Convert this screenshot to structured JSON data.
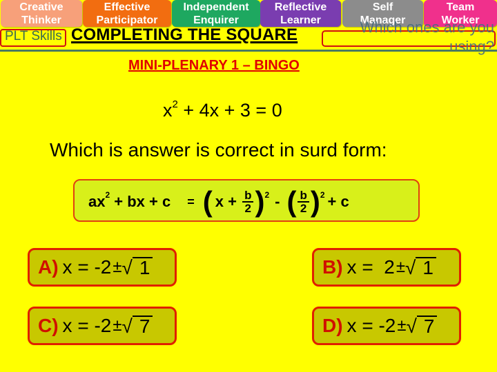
{
  "plt_skills": [
    {
      "line1": "Creative",
      "line2": "Thinker",
      "color": "#f7a07a"
    },
    {
      "line1": "Effective",
      "line2": "Participator",
      "color": "#f26d10"
    },
    {
      "line1": "Independent",
      "line2": "Enquirer",
      "color": "#1ea860"
    },
    {
      "line1": "Reflective",
      "line2": "Learner",
      "color": "#7a3db0"
    },
    {
      "line1": "Self",
      "line2": "Manager",
      "color": "#8c8c8c"
    },
    {
      "line1": "Team",
      "line2": "Worker",
      "color": "#f0308c"
    }
  ],
  "plt_label": "PLT Skills",
  "which_ones_prompt": "Which ones are you using?",
  "title": "COMPLETING THE SQUARE",
  "subtitle": "MINI-PLENARY 1 – BINGO",
  "equation": {
    "x_term": "x",
    "x_exp": "2",
    "rest": " + 4x + 3 = 0"
  },
  "question": "Which is answer is correct in surd form:",
  "formula": {
    "lhs_a": "ax",
    "lhs_exp": "2",
    "lhs_rest": " + bx + c",
    "equals": "=",
    "open_paren": "(",
    "x_plus": "x + ",
    "frac_num": "b",
    "frac_den": "2",
    "close_paren": ")",
    "exp": "2",
    "minus": "-",
    "plus_c": "+ c"
  },
  "answers": [
    {
      "letter": "A)",
      "prefix": "x = -2",
      "pm": "±",
      "radicand": "1"
    },
    {
      "letter": "B)",
      "prefix": "x =  2",
      "pm": "±",
      "radicand": "1"
    },
    {
      "letter": "C)",
      "prefix": "x = -2",
      "pm": "±",
      "radicand": "7"
    },
    {
      "letter": "D)",
      "prefix": "x = -2",
      "pm": "±",
      "radicand": "7"
    }
  ]
}
